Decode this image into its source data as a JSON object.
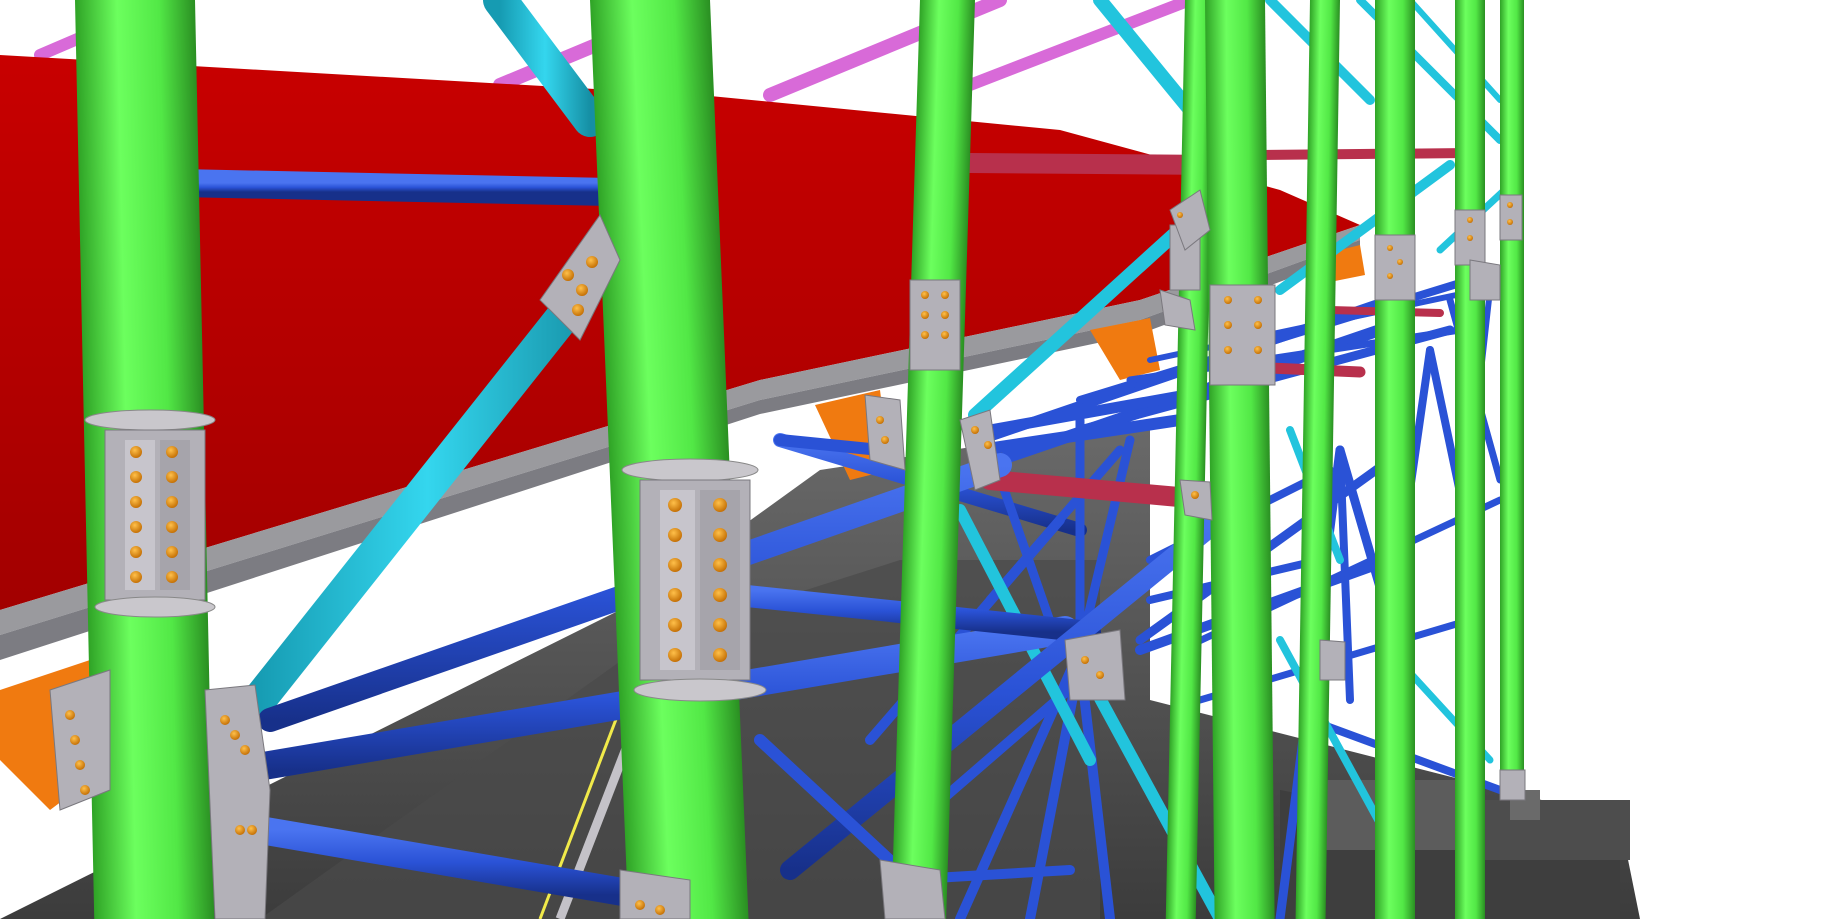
{
  "scene": {
    "kind": "3D structural steel model render",
    "colors": {
      "background": "#ffffff",
      "column_green": "#55ee4a",
      "column_green_dark": "#2fa326",
      "brace_blue": "#2a52d6",
      "brace_blue_dark": "#1a3290",
      "brace_cyan": "#22c4dd",
      "beam_magenta": "#d86ad8",
      "beam_crimson": "#b8304c",
      "slab_red": "#bb0000",
      "plate_orange": "#f07a10",
      "connection_gray": "#b3b1b8",
      "ground_gray": "#555555",
      "bolt_orange": "#e08a00",
      "guide_yellow": "#f1ea4a"
    }
  }
}
